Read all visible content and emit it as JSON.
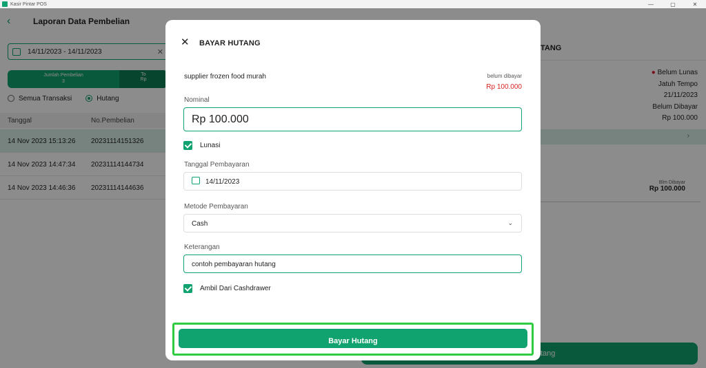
{
  "window": {
    "title": "Kasir Pintar POS",
    "controls": [
      "—",
      "▢",
      "✕"
    ]
  },
  "background": {
    "page_title": "Laporan Data Pembelian",
    "date_range": "14/11/2023 - 14/11/2023",
    "summary": {
      "card1_label": "Jumlah Pembelian",
      "card1_value": "3",
      "card2_label": "To",
      "card2_value": "Rp"
    },
    "filters": {
      "all": "Semua Transaksi",
      "debt": "Hutang"
    },
    "table_headers": [
      "Tanggal",
      "No.Pembelian"
    ],
    "rows": [
      {
        "date": "14 Nov 2023 15:13:26",
        "number": "20231114151326"
      },
      {
        "date": "14 Nov 2023 14:47:34",
        "number": "20231114144734"
      },
      {
        "date": "14 Nov 2023 14:46:36",
        "number": "20231114144636"
      }
    ],
    "right_header": "TANG",
    "right_info": {
      "status": "Belum Lunas",
      "due_label": "Jatuh Tempo",
      "due_date": "21/11/2023",
      "unpaid_label": "Belum Dibayar",
      "unpaid_amount": "Rp 100.000"
    },
    "right_item": {
      "label": "Blm Dibayar",
      "amount": "Rp 100.000"
    },
    "right_button": "tang"
  },
  "modal": {
    "title": "BAYAR HUTANG",
    "supplier": "supplier frozen food murah",
    "status_label": "belum dibayar",
    "status_amount": "Rp 100.000",
    "nominal_label": "Nominal",
    "nominal_value": "Rp 100.000",
    "settle_label": "Lunasi",
    "date_label": "Tanggal Pembayaran",
    "date_value": "14/11/2023",
    "method_label": "Metode Pembayaran",
    "method_value": "Cash",
    "note_label": "Keterangan",
    "note_value": "contoh pembayaran hutang",
    "cashdrawer_label": "Ambil Dari Cashdrawer",
    "pay_button": "Bayar Hutang"
  },
  "colors": {
    "primary": "#11a36f",
    "danger": "#d8201f",
    "highlight": "#2ecc40"
  }
}
